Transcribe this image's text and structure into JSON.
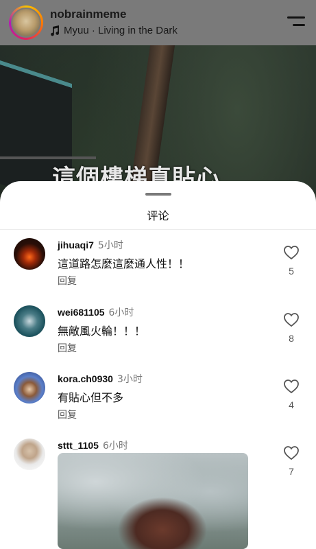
{
  "header": {
    "username": "nobrainmeme",
    "music": "Myuu · Living in the Dark"
  },
  "video": {
    "caption": "這個樓梯真貼心"
  },
  "sheet": {
    "title": "评论"
  },
  "comments": [
    {
      "user": "jihuaqi7",
      "time": "5小时",
      "text": "這道路怎麼這麼通人性！！",
      "reply": "回复",
      "likes": "5"
    },
    {
      "user": "wei681105",
      "time": "6小时",
      "text": "無敵風火輪！！！",
      "reply": "回复",
      "likes": "8"
    },
    {
      "user": "kora.ch0930",
      "time": "3小时",
      "text": "有貼心但不多",
      "reply": "回复",
      "likes": "4"
    },
    {
      "user": "sttt_1105",
      "time": "6小时",
      "likes": "7"
    }
  ],
  "colors": {
    "header_bg": "#7a7a7a",
    "sheet_bg": "#ffffff",
    "text": "#111111",
    "muted": "#777777"
  },
  "icons": {
    "music": "music-note-icon",
    "menu": "menu-icon",
    "like": "heart-icon"
  }
}
